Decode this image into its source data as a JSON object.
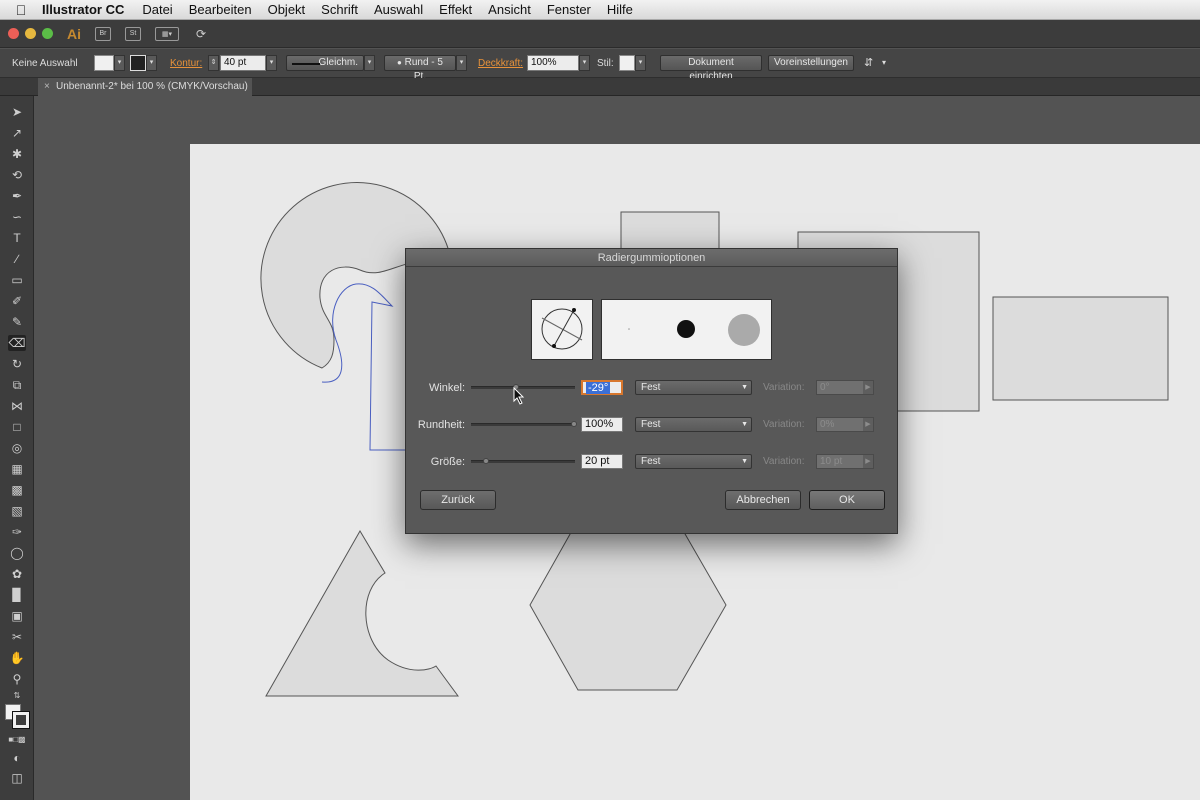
{
  "menubar": {
    "app_name": "Illustrator CC",
    "menus": [
      "Datei",
      "Bearbeiten",
      "Objekt",
      "Schrift",
      "Auswahl",
      "Effekt",
      "Ansicht",
      "Fenster",
      "Hilfe"
    ]
  },
  "appbar": {
    "logo": "Ai",
    "bridge": "Br",
    "stock": "St"
  },
  "controlbar": {
    "selection": "Keine Auswahl",
    "stroke_label": "Kontur:",
    "stroke_weight": "40 pt",
    "profile": "Gleichm.",
    "brush": "Rund - 5 Pt.",
    "opacity_label": "Deckkraft:",
    "opacity": "100%",
    "style_label": "Stil:",
    "doc_setup": "Dokument einrichten",
    "preferences": "Voreinstellungen"
  },
  "document": {
    "tab_title": "Unbenannt-2* bei 100 % (CMYK/Vorschau)"
  },
  "dialog": {
    "title": "Radiergummioptionen",
    "rows": [
      {
        "label": "Winkel:",
        "value": "-29°",
        "mode": "Fest",
        "variation_label": "Variation:",
        "variation": "0°",
        "slider": 0.42
      },
      {
        "label": "Rundheit:",
        "value": "100%",
        "mode": "Fest",
        "variation_label": "Variation:",
        "variation": "0%",
        "slider": 1.0
      },
      {
        "label": "Größe:",
        "value": "20 pt",
        "mode": "Fest",
        "variation_label": "Variation:",
        "variation": "10 pt",
        "slider": 0.12
      }
    ],
    "reset": "Zurück",
    "cancel": "Abbrechen",
    "ok": "OK"
  },
  "colors": {
    "accent": "#e8923a",
    "selection": "#3b6fd6",
    "shape_fill": "#dcdcdc",
    "path_blue": "#4a5fc1"
  }
}
